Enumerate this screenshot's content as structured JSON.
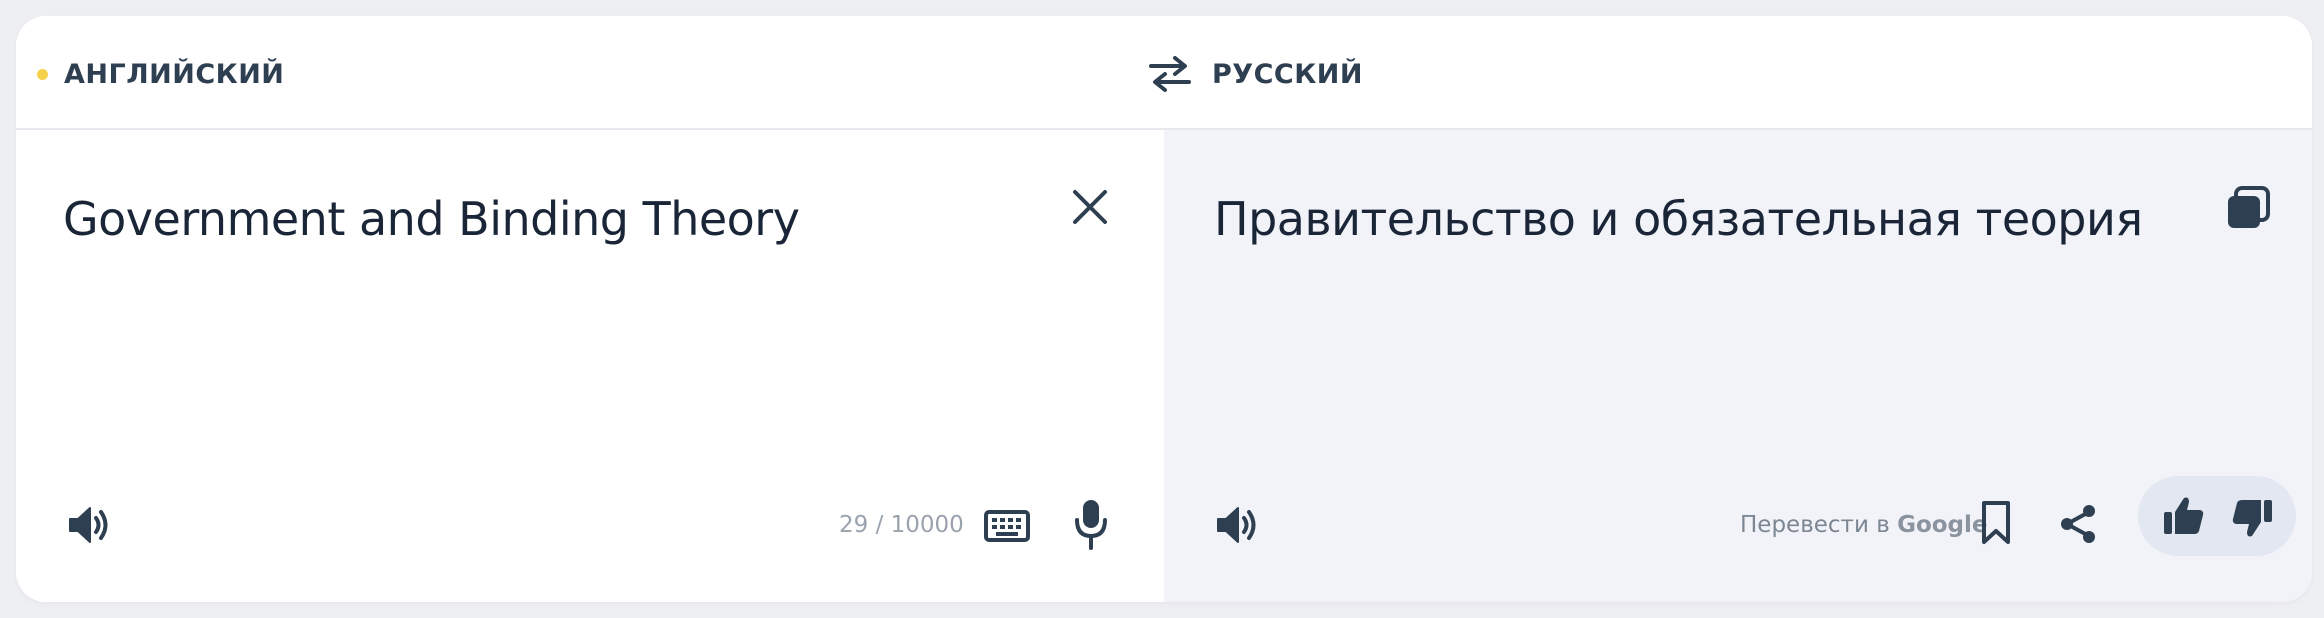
{
  "header": {
    "source_lang": "АНГЛИЙСКИЙ",
    "target_lang": "РУССКИЙ",
    "swap_icon": "swap-arrows-icon"
  },
  "source": {
    "text": "Government and Binding Theory",
    "char_count": "29 / 10000",
    "icons": [
      "close-icon",
      "speaker-icon",
      "keyboard-icon",
      "microphone-icon"
    ]
  },
  "target": {
    "text": "Правительство и обязательная теория",
    "google_label": "Перевести в ",
    "google_brand": "Google",
    "icons": [
      "copy-icon",
      "speaker-icon",
      "bookmark-icon",
      "share-icon",
      "thumbs-up-icon",
      "thumbs-down-icon"
    ]
  },
  "colors": {
    "accent_dot": "#f6d24a",
    "icon": "#2f3f52",
    "target_bg": "#f1f3f8"
  }
}
